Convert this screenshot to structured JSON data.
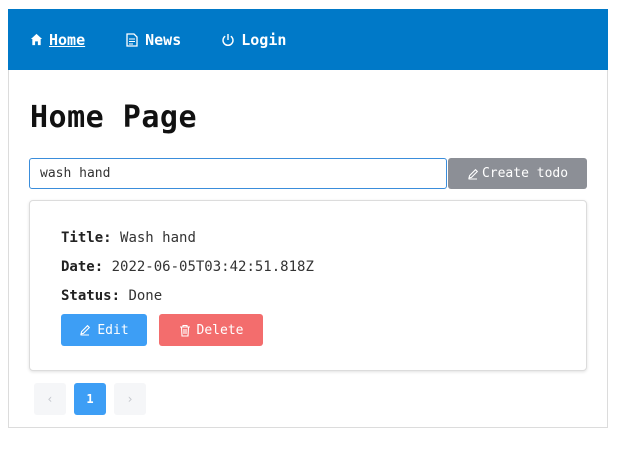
{
  "navbar": {
    "items": [
      {
        "label": "Home",
        "icon": "home-icon",
        "active": true
      },
      {
        "label": "News",
        "icon": "document-icon",
        "active": false
      },
      {
        "label": "Login",
        "icon": "power-icon",
        "active": false
      }
    ],
    "color": "#0079c8"
  },
  "page": {
    "title": "Home Page"
  },
  "form": {
    "input_value": "wash hand",
    "create_label": "Create todo"
  },
  "todo": {
    "title_label": "Title:",
    "title_value": "Wash hand",
    "date_label": "Date:",
    "date_value": "2022-06-05T03:42:51.818Z",
    "status_label": "Status:",
    "status_value": "Done",
    "edit_label": "Edit",
    "delete_label": "Delete"
  },
  "pagination": {
    "prev": "‹",
    "current": "1",
    "next": "›"
  }
}
